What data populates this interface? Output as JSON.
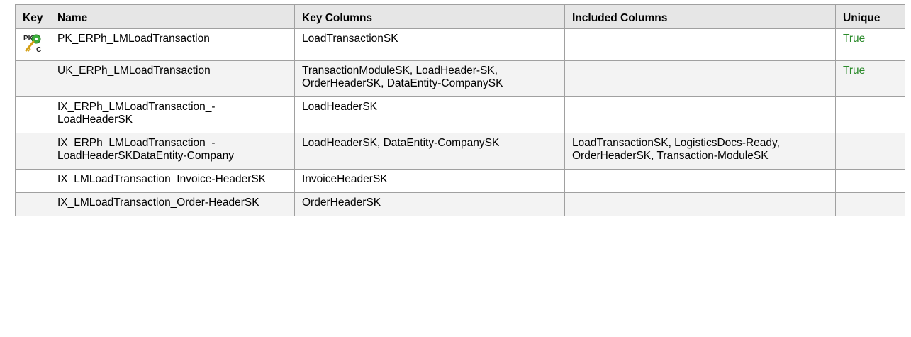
{
  "columns": {
    "key": "Key",
    "name": "Name",
    "key_columns": "Key Columns",
    "included_columns": "Included Columns",
    "unique": "Unique"
  },
  "rows": [
    {
      "key_icon": "primary-key-icon",
      "name": "PK_ERPh_LMLoadTransaction",
      "key_columns": "LoadTransactionSK",
      "included_columns": "",
      "unique": "True"
    },
    {
      "key_icon": "",
      "name": "UK_ERPh_LMLoadTransaction",
      "key_columns": "TransactionModuleSK, LoadHeader-SK, OrderHeaderSK, DataEntity-CompanySK",
      "included_columns": "",
      "unique": "True"
    },
    {
      "key_icon": "",
      "name": "IX_ERPh_LMLoadTransaction_-LoadHeaderSK",
      "key_columns": "LoadHeaderSK",
      "included_columns": "",
      "unique": ""
    },
    {
      "key_icon": "",
      "name": "IX_ERPh_LMLoadTransaction_-LoadHeaderSKDataEntity-Company",
      "key_columns": "LoadHeaderSK, DataEntity-CompanySK",
      "included_columns": "LoadTransactionSK, LogisticsDocs-Ready, OrderHeaderSK, Transaction-ModuleSK",
      "unique": ""
    },
    {
      "key_icon": "",
      "name": "IX_LMLoadTransaction_Invoice-HeaderSK",
      "key_columns": "InvoiceHeaderSK",
      "included_columns": "",
      "unique": ""
    },
    {
      "key_icon": "",
      "name": "IX_LMLoadTransaction_Order-HeaderSK",
      "key_columns": "OrderHeaderSK",
      "included_columns": "",
      "unique": ""
    }
  ],
  "colors": {
    "header_bg": "#e6e6e6",
    "alt_row_bg": "#f3f3f3",
    "border": "#a0a0a0",
    "unique_true": "#2a8a2a"
  }
}
